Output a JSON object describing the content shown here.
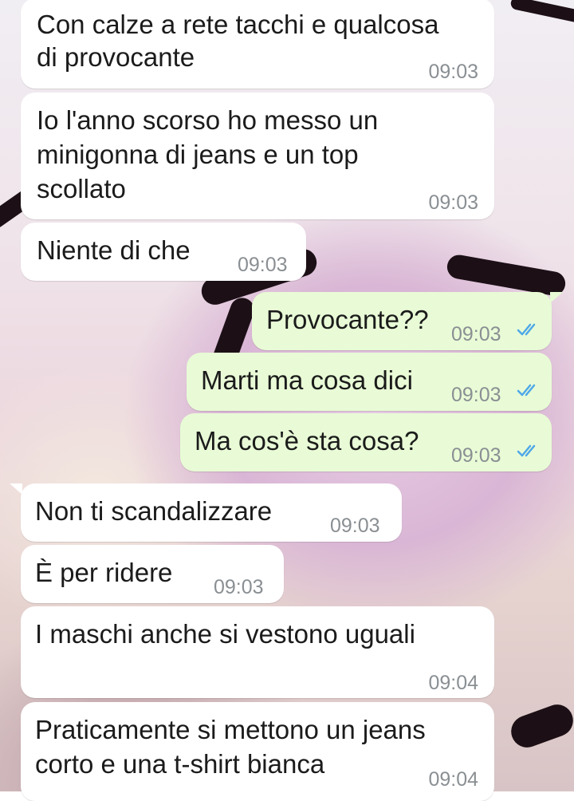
{
  "chat": {
    "messages": [
      {
        "direction": "in",
        "lines": [
          "Con calze a rete tacchi e qualcosa",
          "di provocante"
        ],
        "time": "09:03"
      },
      {
        "direction": "in",
        "lines": [
          "Io l'anno scorso ho messo un",
          "minigonna di jeans e un top",
          "scollato"
        ],
        "time": "09:03"
      },
      {
        "direction": "in",
        "lines": [
          "Niente di che"
        ],
        "time": "09:03"
      },
      {
        "direction": "out",
        "lines": [
          "Provocante??"
        ],
        "time": "09:03",
        "status": "read",
        "status_icon": "double-check-icon",
        "status_color": "#4fa8e8"
      },
      {
        "direction": "out",
        "lines": [
          "Marti ma cosa dici"
        ],
        "time": "09:03",
        "status": "read",
        "status_icon": "double-check-icon",
        "status_color": "#4fa8e8"
      },
      {
        "direction": "out",
        "lines": [
          "Ma cos'è sta cosa?"
        ],
        "time": "09:03",
        "status": "read",
        "status_icon": "double-check-icon",
        "status_color": "#4fa8e8"
      },
      {
        "direction": "in",
        "lines": [
          "Non ti scandalizzare"
        ],
        "time": "09:03"
      },
      {
        "direction": "in",
        "lines": [
          "È per ridere"
        ],
        "time": "09:03"
      },
      {
        "direction": "in",
        "lines": [
          "I maschi anche si vestono uguali"
        ],
        "time": "09:04"
      },
      {
        "direction": "in",
        "lines": [
          "Praticamente si mettono un jeans",
          "corto e una t-shirt bianca"
        ],
        "time": "09:04"
      }
    ]
  },
  "colors": {
    "incoming_bubble": "#ffffff",
    "outgoing_bubble": "#e8fbd6",
    "timestamp": "#8a8f93",
    "read_tick": "#4fa8e8"
  }
}
